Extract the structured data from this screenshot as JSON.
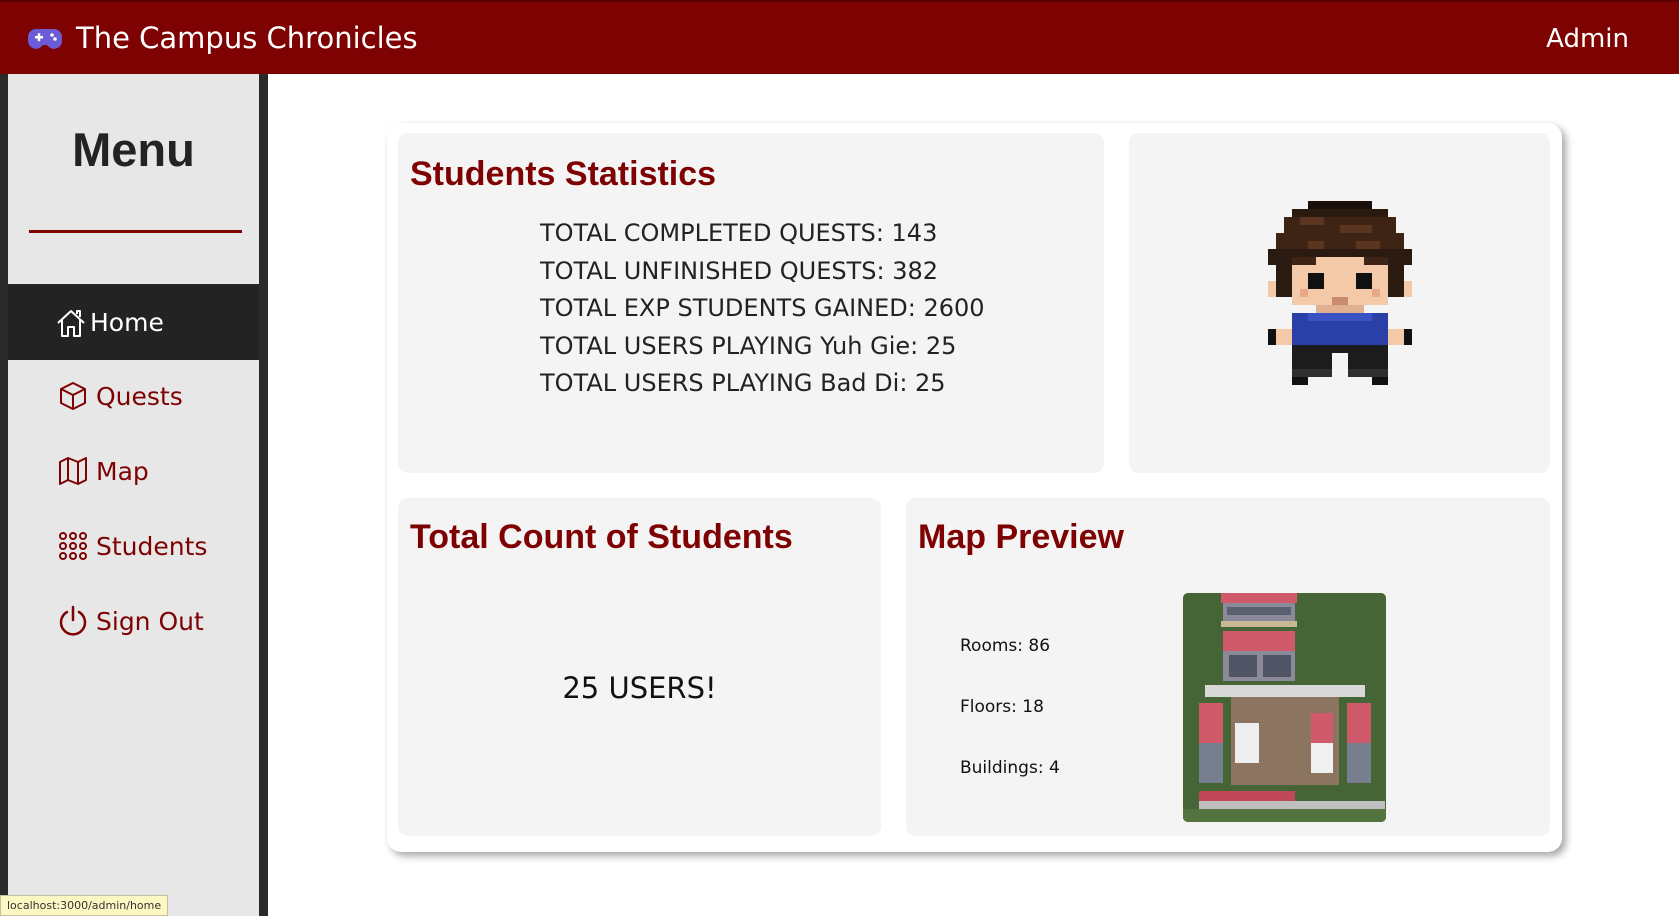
{
  "header": {
    "title": "The Campus Chronicles",
    "brand_icon": "gamepad-icon",
    "user_label": "Admin"
  },
  "sidebar": {
    "menu_title": "Menu",
    "items": [
      {
        "label": "Home",
        "icon": "home-icon",
        "active": true
      },
      {
        "label": "Quests",
        "icon": "cube-icon",
        "active": false
      },
      {
        "label": "Map",
        "icon": "map-icon",
        "active": false
      },
      {
        "label": "Students",
        "icon": "grid-dots-icon",
        "active": false
      },
      {
        "label": "Sign Out",
        "icon": "power-icon",
        "active": false
      }
    ]
  },
  "stats": {
    "title": "Students Statistics",
    "lines": [
      "TOTAL COMPLETED QUESTS: 143",
      "TOTAL UNFINISHED QUESTS: 382",
      "TOTAL EXP STUDENTS GAINED: 2600",
      "TOTAL USERS PLAYING Yuh Gie: 25",
      "TOTAL USERS PLAYING Bad Di: 25"
    ]
  },
  "count": {
    "title": "Total Count of Students",
    "value": "25 USERS!"
  },
  "map_preview": {
    "title": "Map Preview",
    "rooms": "Rooms: 86",
    "floors": "Floors: 18",
    "buildings": "Buildings: 4"
  },
  "status_bar": {
    "url": "localhost:3000/admin/home"
  },
  "colors": {
    "brand": "#7f0203",
    "sidebar_dark": "#232323",
    "card_bg": "#f4f4f4"
  }
}
